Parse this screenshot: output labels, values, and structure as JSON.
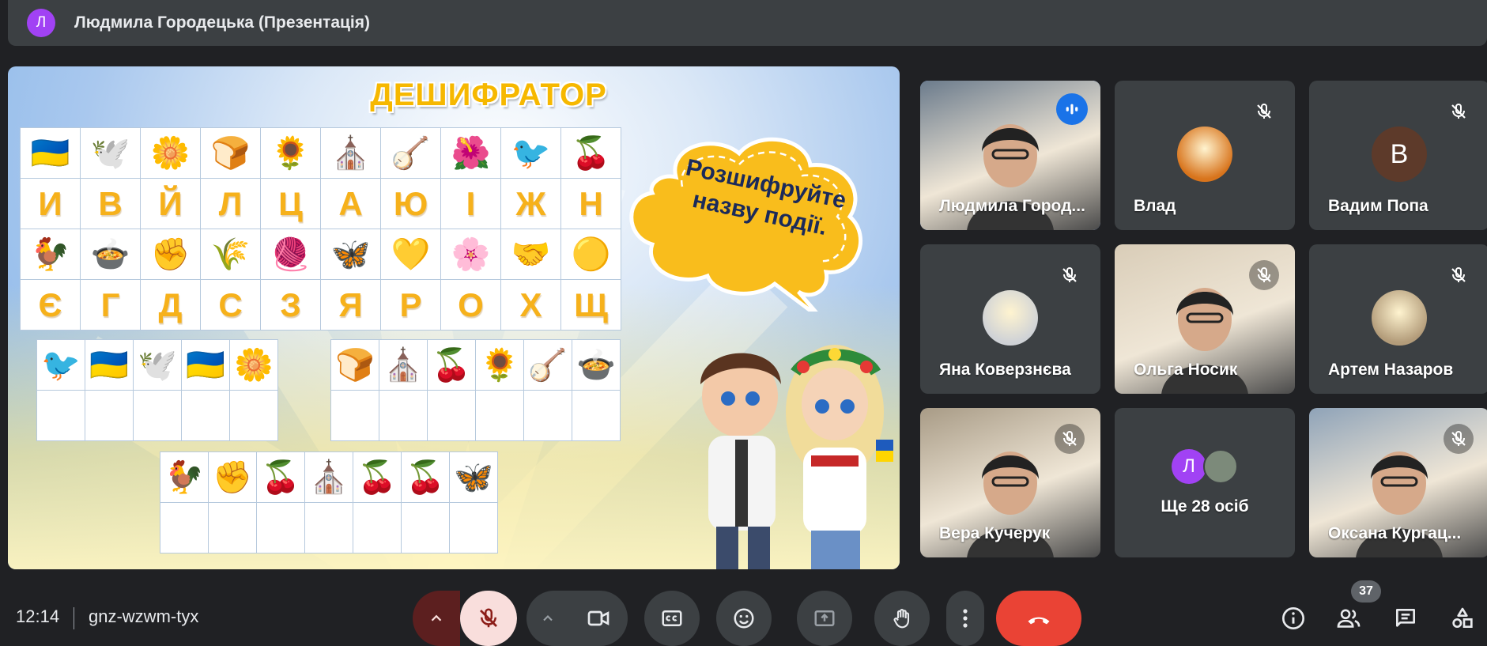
{
  "header": {
    "avatar_letter": "Л",
    "title": "Людмила Городецька (Презентація)"
  },
  "slide": {
    "title": "ДЕШИФРАТОР",
    "cloud_text_line1": "Розшифруйте",
    "cloud_text_line2": "назву події.",
    "picture_row1": [
      "🇺🇦",
      "🕊️",
      "🌼",
      "🍞",
      "🌻",
      "⛪",
      "🪕",
      "🌺",
      "🐦",
      "🍒"
    ],
    "letter_row1": [
      "И",
      "В",
      "Й",
      "Л",
      "Ц",
      "А",
      "Ю",
      "І",
      "Ж",
      "Н"
    ],
    "picture_row2": [
      "🐓",
      "🍲",
      "✊",
      "🌾",
      "🧶",
      "🦋",
      "💛",
      "🌸",
      "🤝",
      "🟡"
    ],
    "letter_row2": [
      "Є",
      "Г",
      "Д",
      "С",
      "З",
      "Я",
      "Р",
      "О",
      "Х",
      "Щ"
    ],
    "puzzle1": [
      "🐦",
      "🇺🇦",
      "🕊️",
      "🇺🇦",
      "🌼"
    ],
    "puzzle2": [
      "🍞",
      "⛪",
      "🍒",
      "🌻",
      "🪕",
      "🍲"
    ],
    "puzzle3": [
      "🐓",
      "✊",
      "🍒",
      "⛪",
      "🍒",
      "🍒",
      "🦋"
    ]
  },
  "participants": [
    {
      "name": "Людмила Город...",
      "avatar": "",
      "color": "#6b7b8c",
      "active": true,
      "speaking": true
    },
    {
      "name": "Влад",
      "avatar": "",
      "color": "#d8741c",
      "active": false,
      "speaking": false
    },
    {
      "name": "Вадим Попа",
      "avatar": "В",
      "color": "#5d3a2a",
      "active": false,
      "speaking": false
    },
    {
      "name": "Яна Коверзнєва",
      "avatar": "",
      "color": "#cfd2d6",
      "active": false,
      "speaking": false
    },
    {
      "name": "Ольга Носик",
      "avatar": "",
      "color": "#d9cdb8",
      "active": false,
      "speaking": false
    },
    {
      "name": "Артем Назаров",
      "avatar": "",
      "color": "#b39c7a",
      "active": false,
      "speaking": false
    },
    {
      "name": "Вера Кучерук",
      "avatar": "",
      "color": "#a89b86",
      "active": false,
      "speaking": false
    },
    {
      "name": "Ще 28 осіб",
      "avatar": "Л",
      "color": "#a142f4",
      "active": false,
      "speaking": false
    },
    {
      "name": "Оксана Кургац...",
      "avatar": "",
      "color": "#8fa3b8",
      "active": false,
      "speaking": false
    }
  ],
  "bottom": {
    "time": "12:14",
    "meeting_code": "gnz-wzwm-tyx",
    "people_count": "37"
  },
  "colors": {
    "end_call": "#ea4335",
    "mic_muted_bg": "#f9dedc",
    "accent": "#8ab4f8"
  }
}
